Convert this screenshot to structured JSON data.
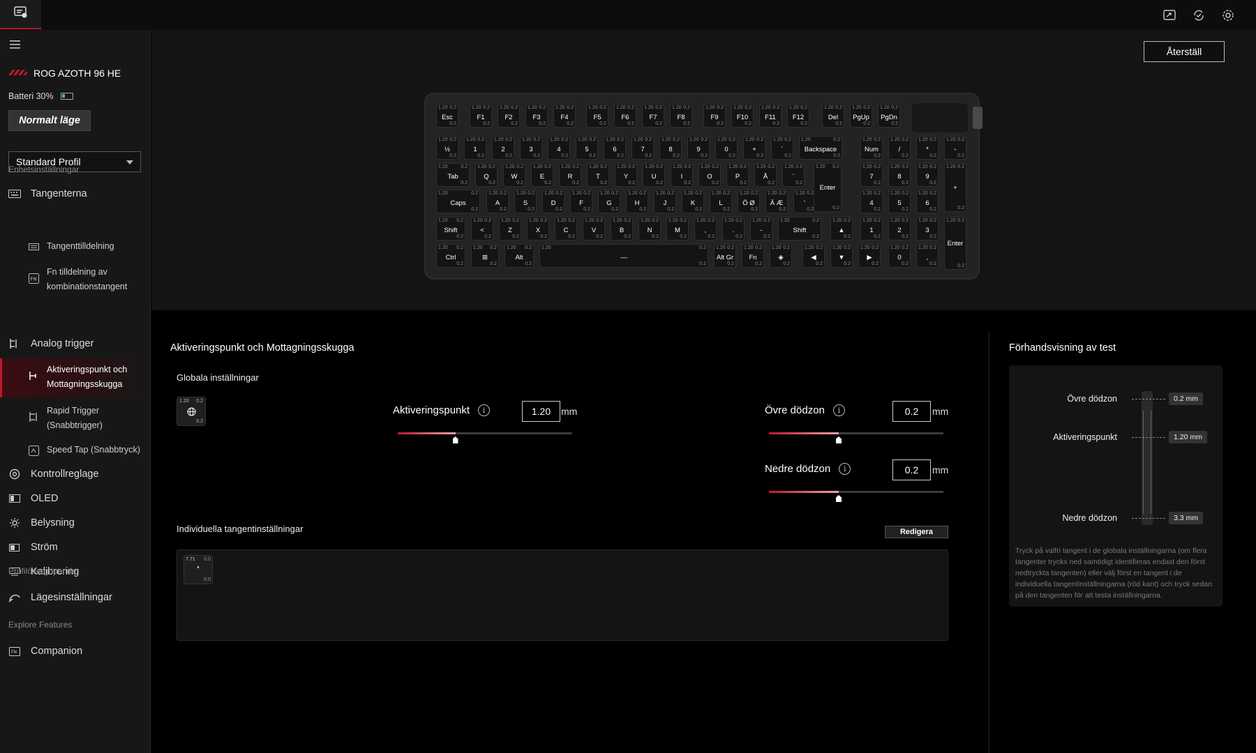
{
  "header": {
    "icons": [
      "app-icon",
      "screen-capture-icon",
      "sync-icon",
      "settings-icon"
    ]
  },
  "sidebar": {
    "device_name": "ROG AZOTH 96 HE",
    "battery_text": "Batteri 30%",
    "battery_level": 0.3,
    "mode_button": "Normalt läge",
    "profile_select": "Standard Profil",
    "section_device": "Enhetsinställningar",
    "nav": {
      "keys": "Tangenterna",
      "key_assign": "Tangenttilldelning",
      "fn_assign_1": "Fn tilldelning av",
      "fn_assign_2": "kombinationstangent",
      "analog": "Analog trigger",
      "actuation_1": "Aktiveringspunkt och",
      "actuation_2": "Mottagningsskugga",
      "rapid_1": "Rapid Trigger",
      "rapid_2": "(Snabbtrigger)",
      "speedtap": "Speed Tap (Snabbtryck)",
      "controls": "Kontrollreglage",
      "oled": "OLED",
      "lighting": "Belysning",
      "power": "Ström",
      "calibration": "Kalibrering"
    },
    "section_profile": "Profilövergripande",
    "mode_settings": "Lägesinställningar",
    "section_explore": "Explore Features",
    "companion": "Companion"
  },
  "keyboard": {
    "reset_button": "Återställ",
    "default_top_left": "1.20",
    "default_top_right": "0.2",
    "default_bottom_right": "0.2"
  },
  "settings": {
    "title": "Aktiveringspunkt och Mottagningsskugga",
    "global_label": "Globala inställningar",
    "global_key": {
      "tl": "1.20",
      "tr": "0.2",
      "br": "0.2"
    },
    "actuation_label": "Aktiveringspunkt",
    "actuation_value": "1.20",
    "actuation_fraction": 0.33,
    "upper_label": "Övre dödzon",
    "upper_value": "0.2",
    "upper_fraction": 0.4,
    "lower_label": "Nedre dödzon",
    "lower_value": "0.2",
    "lower_fraction": 0.4,
    "unit": "mm",
    "individual_label": "Individuella tangentinställningar",
    "edit_button": "Redigera",
    "individual_key": {
      "tl": "7.71",
      "tr": "0.0",
      "br": "0.0"
    }
  },
  "preview": {
    "title": "Förhandsvisning av test",
    "upper_label": "Övre dödzon",
    "upper_value": "0.2 mm",
    "actuation_label": "Aktiveringspunkt",
    "actuation_value": "1.20 mm",
    "lower_label": "Nedre dödzon",
    "lower_value": "3.3 mm",
    "hint": "Tryck på valfri tangent i de globala inställningarna (om flera tangenter trycks ned samtidigt identifieras endast den först nedtryckta tangenten) eller välj först en tangent i de individuella tangentinställningarna (röd kant) och tryck sedan på den tangenten för att testa inställningarna."
  },
  "colors": {
    "accent": "#c0162c",
    "badge_green": "#3fd14b"
  }
}
